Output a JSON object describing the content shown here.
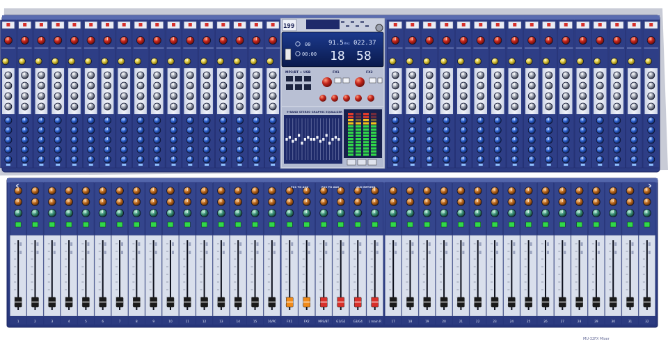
{
  "display": {
    "track_no": "199",
    "freq": "91.5",
    "unit": "MHz",
    "time": "022.37",
    "big_left": "18",
    "big_right": "58",
    "mini_a": "00",
    "mini_b": "00:00"
  },
  "mp3_label": "MP3/BT + USB",
  "fx1_label": "FX1",
  "fx2_label": "FX2",
  "eq_label": "9-BAND STEREO GRAPHIC EQUALIZER",
  "sub_labels": [
    "FX1 TO AUX",
    "FX2 TO AUX",
    "AUX RETURN"
  ],
  "bottom_caption": "MU-32FX Mixer",
  "nav": {
    "prev": "‹",
    "next": "›"
  },
  "left_channel_labels": [
    "1",
    "2",
    "3",
    "4",
    "5",
    "6",
    "7",
    "8",
    "9",
    "10",
    "11",
    "12",
    "13",
    "14",
    "15",
    "16/PC"
  ],
  "center_channel_labels": [
    "FX1",
    "FX2",
    "MP3/BT",
    "G1/G2",
    "G3/G4",
    "L main R"
  ],
  "right_channel_labels": [
    "17",
    "18",
    "19",
    "20",
    "21",
    "22",
    "23",
    "24",
    "25",
    "26",
    "27",
    "28",
    "29",
    "30",
    "31",
    "32"
  ],
  "colors": {
    "body": "#2f3f84",
    "panel_light": "#dde3f0",
    "accent_red": "#d8302a",
    "accent_orange": "#f08a1a",
    "led_green": "#31d84a"
  }
}
